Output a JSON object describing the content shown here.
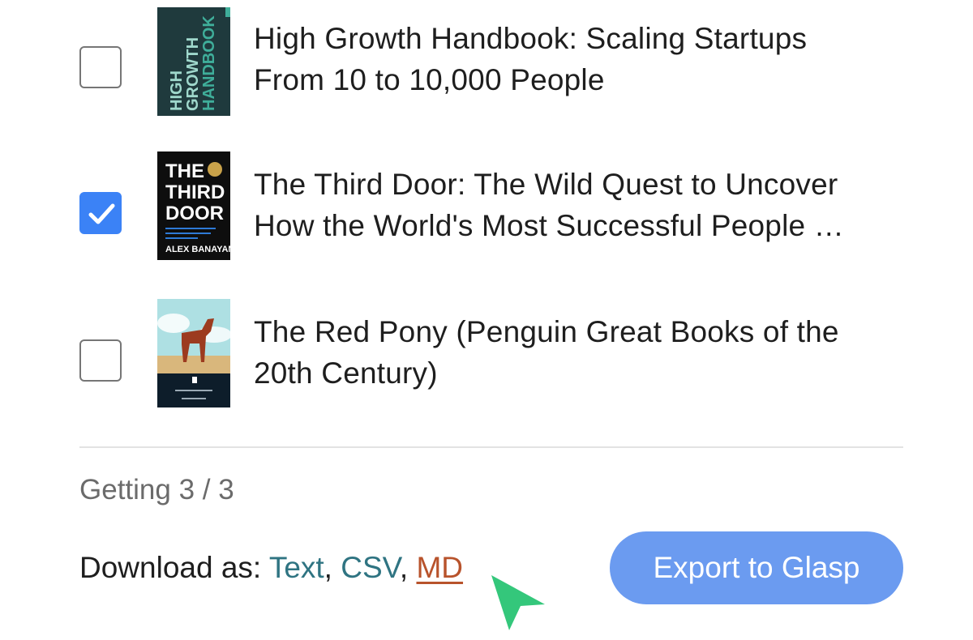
{
  "books": [
    {
      "title_line1": "High Growth Handbook: Scaling Startups",
      "title_line2": "From 10 to 10,000 People",
      "checked": false,
      "cover_text": [
        "HIGH",
        "GROWTH",
        "HANDBOOK"
      ]
    },
    {
      "title_line1": "The Third Door: The Wild Quest to Uncover",
      "title_line2": "How the World's Most Successful People …",
      "checked": true,
      "cover_text": [
        "THE",
        "THIRD",
        "DOOR",
        "ALEX BANAYAN"
      ]
    },
    {
      "title_line1": "The Red Pony (Penguin Great Books of the",
      "title_line2": "20th Century)",
      "checked": false
    }
  ],
  "status": "Getting 3 / 3",
  "download": {
    "label": "Download as: ",
    "formats": [
      "Text",
      "CSV",
      "MD"
    ],
    "separator": ", "
  },
  "export_button": "Export to Glasp",
  "colors": {
    "checkbox_checked": "#3b82f6",
    "link": "#2f7482",
    "link_active": "#b8532c",
    "export_button": "#6b9bf0",
    "cursor": "#34c77b"
  }
}
